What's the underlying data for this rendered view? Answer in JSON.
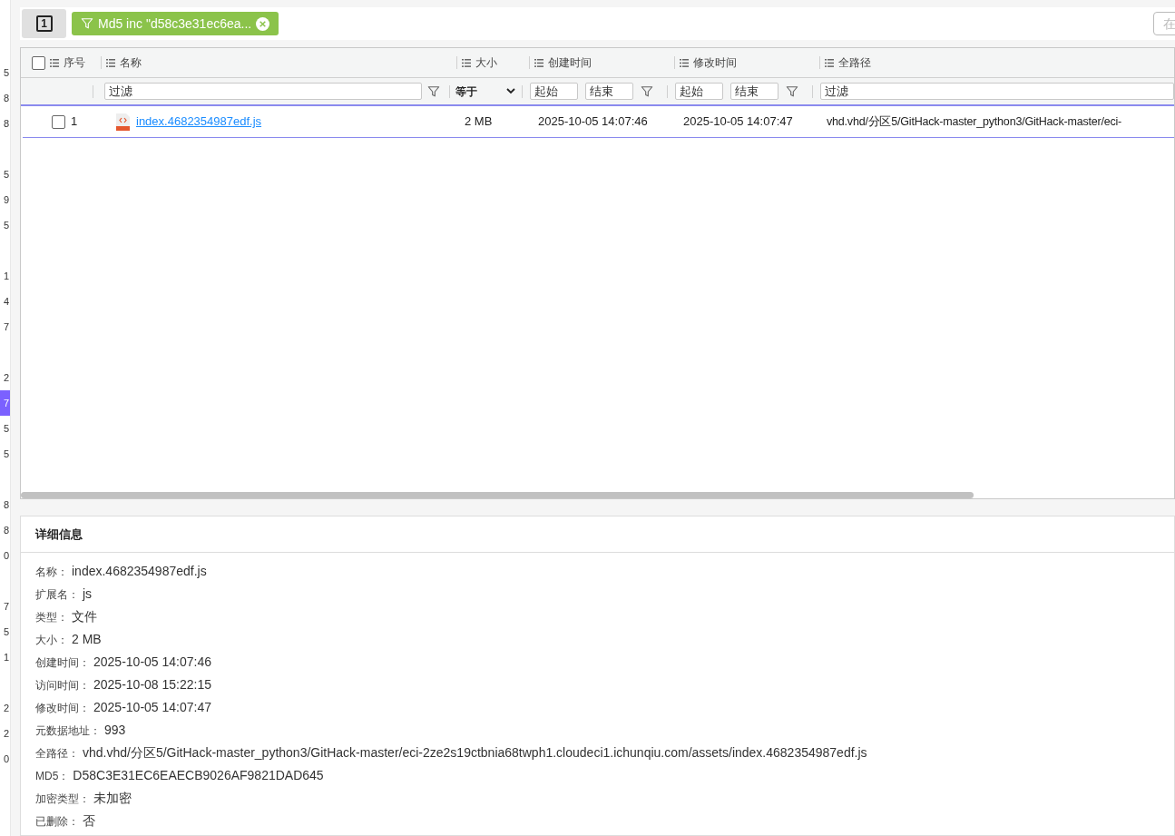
{
  "side_list": [
    {
      "label": "5",
      "selected": false
    },
    {
      "label": "8",
      "selected": false
    },
    {
      "label": "8",
      "selected": false
    },
    {
      "selected": false
    },
    {
      "label": "5",
      "selected": false
    },
    {
      "label": "9",
      "selected": false
    },
    {
      "label": "5",
      "selected": false
    },
    {
      "selected": false
    },
    {
      "label": "1",
      "selected": false
    },
    {
      "label": "4",
      "selected": false
    },
    {
      "label": "7",
      "selected": false
    },
    {
      "selected": false
    },
    {
      "label": "2",
      "selected": false
    },
    {
      "label": "7",
      "selected": true
    },
    {
      "label": "5",
      "selected": false
    },
    {
      "label": "5",
      "selected": false
    },
    {
      "selected": false
    },
    {
      "label": "8",
      "selected": false
    },
    {
      "label": "8",
      "selected": false
    },
    {
      "label": "0",
      "selected": false
    },
    {
      "selected": false
    },
    {
      "label": "7",
      "selected": false
    },
    {
      "label": "5",
      "selected": false
    },
    {
      "label": "1",
      "selected": false
    },
    {
      "selected": false
    },
    {
      "label": "2",
      "selected": false
    },
    {
      "label": "2",
      "selected": false
    },
    {
      "label": "0",
      "selected": false
    }
  ],
  "toolbar": {
    "count_button": "1",
    "filter_chip": "Md5 inc \"d58c3e31ec6ea...",
    "search_placeholder": "在"
  },
  "table": {
    "select_all_checked": false,
    "columns": [
      {
        "label": "序号"
      },
      {
        "label": "名称"
      },
      {
        "label": "大小"
      },
      {
        "label": "创建时间"
      },
      {
        "label": "修改时间"
      },
      {
        "label": "全路径"
      }
    ],
    "filters": {
      "name_placeholder": "过滤",
      "size_op": "等于",
      "created_from_placeholder": "起始",
      "created_to_placeholder": "结束",
      "modified_from_placeholder": "起始",
      "modified_to_placeholder": "结束",
      "path_placeholder": "过滤"
    },
    "rows": [
      {
        "checked": false,
        "index": "1",
        "name": "index.4682354987edf.js",
        "size": "2 MB",
        "created": "2025-10-05 14:07:46",
        "modified": "2025-10-05 14:07:47",
        "path": "vhd.vhd/分区5/GitHack-master_python3/GitHack-master/eci-"
      }
    ]
  },
  "details": {
    "title": "详细信息",
    "fields": [
      {
        "label": "名称：",
        "value": "index.4682354987edf.js"
      },
      {
        "label": "扩展名：",
        "value": "js"
      },
      {
        "label": "类型：",
        "value": "文件"
      },
      {
        "label": "大小：",
        "value": "2 MB"
      },
      {
        "label": "创建时间：",
        "value": "2025-10-05 14:07:46"
      },
      {
        "label": "访问时间：",
        "value": "2025-10-08 15:22:15"
      },
      {
        "label": "修改时间：",
        "value": "2025-10-05 14:07:47"
      },
      {
        "label": "元数据地址：",
        "value": "993"
      },
      {
        "label": "全路径：",
        "value": "vhd.vhd/分区5/GitHack-master_python3/GitHack-master/eci-2ze2s19ctbnia68twph1.cloudeci1.ichunqiu.com/assets/index.4682354987edf.js"
      },
      {
        "label": "MD5：",
        "value": "D58C3E31EC6EAECB9026AF9821DAD645"
      },
      {
        "label": "加密类型：",
        "value": "未加密"
      },
      {
        "label": "已删除：",
        "value": "否"
      }
    ]
  }
}
